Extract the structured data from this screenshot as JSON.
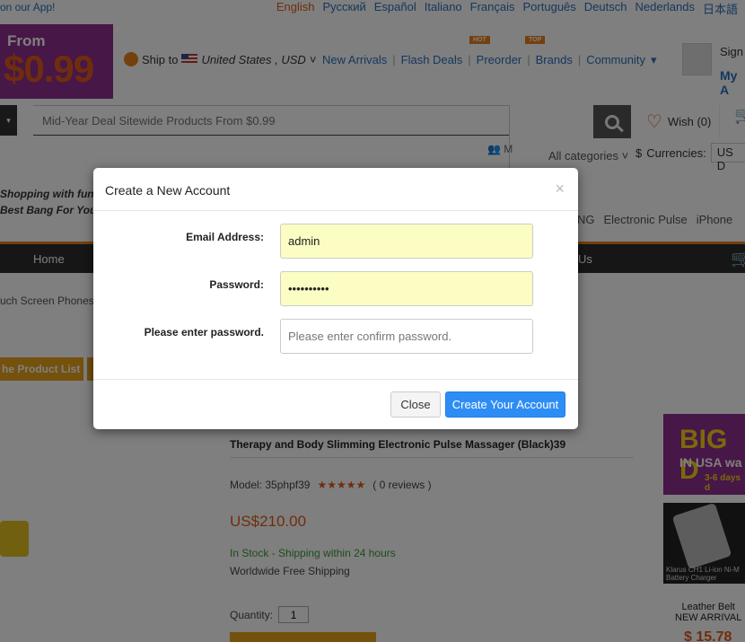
{
  "topbar": {
    "app_link": "on our App!",
    "languages": [
      "English",
      "Русский",
      "Español",
      "Italiano",
      "Français",
      "Português",
      "Deutsch",
      "Nederlands",
      "日本語"
    ]
  },
  "logo": {
    "from": "From",
    "price": "$0.99"
  },
  "ship": {
    "label": "Ship to",
    "country": "United States , USD"
  },
  "nav": {
    "new_arrivals": "New Arrivals",
    "flash_deals": "Flash Deals",
    "preorder": "Preorder",
    "brands": "Brands",
    "community": "Community",
    "hot_tag": "HOT",
    "top_tag": "TOP"
  },
  "account": {
    "sign": "Sign",
    "my": "My A"
  },
  "search": {
    "placeholder": "Mid-Year Deal Sitewide Products From $0.99"
  },
  "wish": {
    "label": "Wish (0)"
  },
  "all_categories": "All categories",
  "currencies": {
    "label": "Currencies:",
    "value": "US D"
  },
  "users_label": "M",
  "slogan": {
    "line1": "Shopping with fun",
    "line2": "Best Bang For Your B"
  },
  "hotwords": [
    "NG",
    "Electronic Pulse",
    "iPhone"
  ],
  "navbar": {
    "home": "Home",
    "us": "Us"
  },
  "breadcrumb": "uch Screen Phones",
  "product_list_button": "he Product List",
  "product": {
    "title": "Therapy and Body Slimming Electronic Pulse Massager (Black)39",
    "model_label": "Model:",
    "model": "35phpf39",
    "stars": "★★★★★",
    "reviews": "( 0 reviews )",
    "price": "US$210.00",
    "stock": "In Stock - Shipping within 24 hours",
    "free_shipping": "Worldwide Free Shipping",
    "quantity_label": "Quantity:",
    "quantity": "1"
  },
  "ads": {
    "big": "BIG D",
    "usa": "IN USA wa",
    "days": "3-6 days d",
    "ad2_caption": "Klarus CH1 Li-ion Ni-M Battery Charger",
    "belt_line1": "Leather Belt",
    "belt_line2": "NEW ARRIVAL",
    "belt_price": "$ 15.78"
  },
  "modal": {
    "title": "Create a New Account",
    "close_x": "×",
    "email_label": "Email Address:",
    "email_value": "admin",
    "password_label": "Password:",
    "password_value": "••••••••••",
    "confirm_label": "Please enter password.",
    "confirm_placeholder": "Please enter confirm password.",
    "close_button": "Close",
    "create_button": "Create Your Account"
  }
}
